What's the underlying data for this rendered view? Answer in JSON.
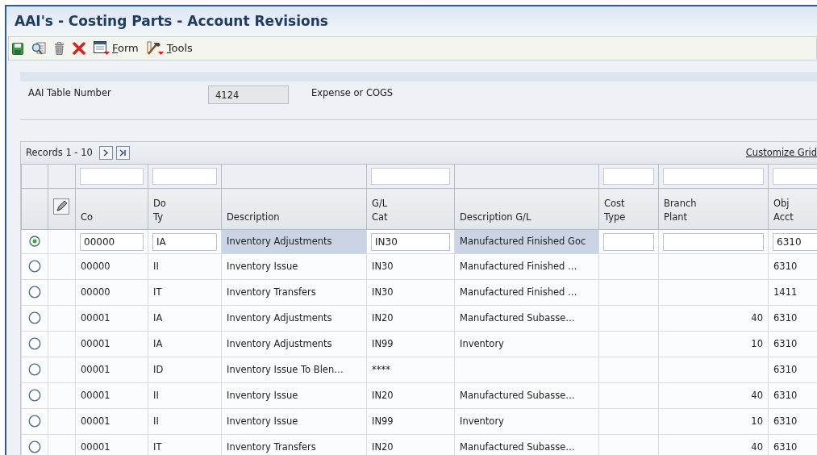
{
  "window": {
    "title": "AAI's - Costing Parts - Account Revisions"
  },
  "toolbar": [
    {
      "kind": "save"
    },
    {
      "kind": "preview"
    },
    {
      "kind": "delete"
    },
    {
      "kind": "cancel"
    },
    {
      "kind": "form",
      "label": "Form"
    },
    {
      "kind": "tools",
      "label": "Tools"
    }
  ],
  "header": {
    "label": "AAI Table Number",
    "value": "4124",
    "description": "Expense or COGS"
  },
  "grid": {
    "records": "Records 1 - 10",
    "customize": "Customize Grid",
    "columns": [
      {
        "label": "Co",
        "filter": true
      },
      {
        "label": "Do\nTy",
        "filter": true
      },
      {
        "label": "Description",
        "filter": false
      },
      {
        "label": "G/L\nCat",
        "filter": true
      },
      {
        "label": "Description G/L",
        "filter": false
      },
      {
        "label": "Cost\nType",
        "filter": true
      },
      {
        "label": "Branch\nPlant",
        "filter": true
      },
      {
        "label": "Obj\nAcct",
        "filter": true
      }
    ],
    "rows": [
      {
        "selected": true,
        "cells": [
          "00000",
          "IA",
          "Inventory Adjustments",
          "IN30",
          "Manufactured Finished Goc",
          null,
          null,
          "6310"
        ]
      },
      {
        "selected": false,
        "cells": [
          "00000",
          "II",
          "Inventory Issue",
          "IN30",
          "Manufactured Finished …",
          null,
          null,
          "6310"
        ]
      },
      {
        "selected": false,
        "cells": [
          "00000",
          "IT",
          "Inventory Transfers",
          "IN30",
          "Manufactured Finished …",
          null,
          null,
          "1411"
        ]
      },
      {
        "selected": false,
        "cells": [
          "00001",
          "IA",
          "Inventory Adjustments",
          "IN20",
          "Manufactured Subasse…",
          null,
          "40",
          "6310"
        ]
      },
      {
        "selected": false,
        "cells": [
          "00001",
          "IA",
          "Inventory Adjustments",
          "IN99",
          "Inventory",
          null,
          "10",
          "6310"
        ]
      },
      {
        "selected": false,
        "cells": [
          "00001",
          "ID",
          "Inventory Issue To Blen…",
          "****",
          null,
          null,
          null,
          "6310"
        ]
      },
      {
        "selected": false,
        "cells": [
          "00001",
          "II",
          "Inventory Issue",
          "IN20",
          "Manufactured Subasse…",
          null,
          "40",
          "6310"
        ]
      },
      {
        "selected": false,
        "cells": [
          "00001",
          "II",
          "Inventory Issue",
          "IN99",
          "Inventory",
          null,
          "10",
          "6310"
        ]
      },
      {
        "selected": false,
        "cells": [
          "00001",
          "IT",
          "Inventory Transfers",
          "IN20",
          "Manufactured Subasse…",
          null,
          "40",
          "6310"
        ]
      }
    ]
  }
}
